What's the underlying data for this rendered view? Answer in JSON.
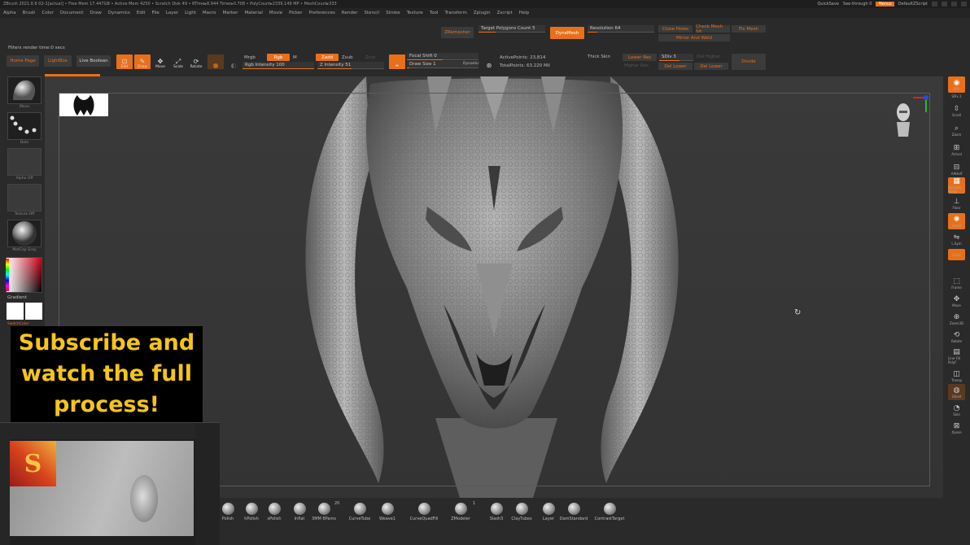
{
  "titlebar": {
    "text": "ZBrush 2021.6.6   02-1[actual]   • Free Mem 17.447GB • Active Mem 4250 • Scratch Disk 49 • RTime▸8.944 Timer▸0.708 • PolyCount▸2339.149 MP • MeshCount▸333",
    "quicksave": "QuickSave",
    "seethrough": "See-through  0",
    "menus": "Menus",
    "script": "DefaultZScript"
  },
  "menu": [
    "Alpha",
    "Brush",
    "Color",
    "Document",
    "Draw",
    "Dynamics",
    "Edit",
    "File",
    "Layer",
    "Light",
    "Macro",
    "Marker",
    "Material",
    "Movie",
    "Picker",
    "Preferences",
    "Render",
    "Stencil",
    "Stroke",
    "Texture",
    "Tool",
    "Transform",
    "Zplugin",
    "Zscript",
    "Help"
  ],
  "toolbar": {
    "filters": "Filters render time:0 secs",
    "home": "Home Page",
    "lightbox": "LightBox",
    "liveboolean": "Live Boolean",
    "edit": "Edit",
    "draw": "Draw",
    "move": "Move",
    "scale": "Scale",
    "rotate": "Rotate",
    "mrgb": "Mrgb",
    "rgb": "Rgb",
    "m": "M",
    "rgb_intensity": "Rgb Intensity 100",
    "zadd": "Zadd",
    "zsub": "Zsub",
    "zcut": "Zcut",
    "z_intensity": "Z Intensity 51",
    "focal_shift": "Focal Shift 0",
    "draw_size": "Draw Size 1",
    "dynamic": "Dynamic",
    "active_points": "ActivePoints: 23,814",
    "total_points": "TotalPoints: 63.220 Mil",
    "zremesher": "ZRemesher",
    "target_poly": "Target Polygons Count 5",
    "dynamesh": "DynaMesh",
    "resolution": "Resolution 64",
    "close_holes": "Close Holes",
    "check_mesh": "Check Mesh Int",
    "fix_mesh": "Fix Mesh",
    "mirror_weld": "Mirror And Weld",
    "thick_skin": "Thick Skin",
    "lower_res": "Lower Res",
    "higher_res": "Higher Res",
    "sdiv": "SDiv 3",
    "del_higher": "Del Higher",
    "del_lower": "Del Lower",
    "del_lower2": "Del Lower",
    "divide": "Divide",
    "reconstruct": "Reconstruct"
  },
  "left": {
    "brush_label": "Move",
    "stroke_label": "Dots",
    "alpha_label": "Alpha Off",
    "texture_label": "Texture Off",
    "material_label": "MatCap Gray",
    "gradient_label": "Gradient",
    "switch_label": "SwitchColor"
  },
  "right": {
    "spix": "SPix 2",
    "items": [
      "BPR",
      "Scroll",
      "Zoom",
      "Actual",
      "AAHalf",
      "Dynamic Persp",
      "Floor",
      "Local",
      "L.Sym",
      "Gxyz",
      "Frame",
      "Move",
      "Zoom3D",
      "Rotate",
      "Line Fill PolyF",
      "Transp",
      "Ghost",
      "Solo",
      "Xpose"
    ]
  },
  "brushes": [
    "Polish",
    "hPolish",
    "sPolish",
    "Inflat",
    "3MM 8Pams",
    "CurveTube",
    "Weave1",
    "CurveQuadFill",
    "ZModeler",
    "Slash3",
    "ClayTubes",
    "Layer",
    "DamStandard",
    "ContrastTarget"
  ],
  "brush_badges": {
    "bpams": "20",
    "zmodeler": "1"
  },
  "banner": {
    "line1": "Subscribe and",
    "line2": "watch the full",
    "line3": "process!"
  },
  "colors": {
    "accent": "#e8701a",
    "banner_text": "#f5c518",
    "bg": "#2b2b2b"
  },
  "icons": {
    "rotate_cursor": "↻"
  }
}
